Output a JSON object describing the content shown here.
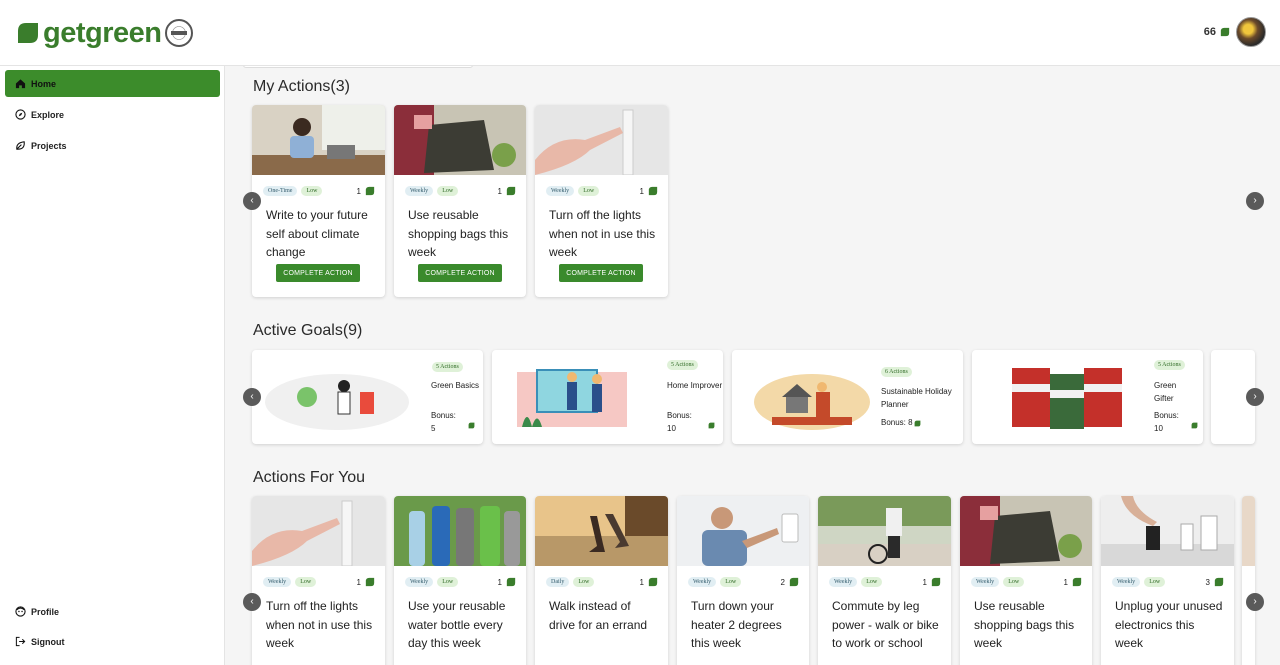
{
  "header": {
    "logo_text": "getgreen",
    "points": "66"
  },
  "sidebar": {
    "items": [
      {
        "label": "Home",
        "icon": "home-icon"
      },
      {
        "label": "Explore",
        "icon": "compass-icon"
      },
      {
        "label": "Projects",
        "icon": "leaf-outline-icon"
      }
    ],
    "bottom_items": [
      {
        "label": "Profile",
        "icon": "profile-face-icon"
      },
      {
        "label": "Signout",
        "icon": "signout-icon"
      }
    ]
  },
  "my_actions": {
    "title": "My Actions(3)",
    "complete_label": "COMPLETE ACTION",
    "cards": [
      {
        "frequency": "One-Time",
        "impact": "Low",
        "points": "1",
        "title": "Write to your future self about climate change"
      },
      {
        "frequency": "Weekly",
        "impact": "Low",
        "points": "1",
        "title": "Use reusable shopping bags this week"
      },
      {
        "frequency": "Weekly",
        "impact": "Low",
        "points": "1",
        "title": "Turn off the lights when not in use this week"
      }
    ]
  },
  "active_goals": {
    "title": "Active Goals(9)",
    "bonus_label": "Bonus:",
    "goals": [
      {
        "actions": "5 Actions",
        "name": "Green Basics",
        "bonus": "5"
      },
      {
        "actions": "5 Actions",
        "name": "Home Improver",
        "bonus": "10"
      },
      {
        "actions": "6 Actions",
        "name": "Sustainable Holiday Planner",
        "bonus": "8"
      },
      {
        "actions": "5 Actions",
        "name": "Green Gifter",
        "bonus": "10"
      }
    ]
  },
  "actions_for_you": {
    "title": "Actions For You",
    "cards": [
      {
        "frequency": "Weekly",
        "impact": "Low",
        "points": "1",
        "title": "Turn off the lights when not in use this week"
      },
      {
        "frequency": "Weekly",
        "impact": "Low",
        "points": "1",
        "title": "Use your reusable water bottle every day this week"
      },
      {
        "frequency": "Daily",
        "impact": "Low",
        "points": "1",
        "title": "Walk instead of drive for an errand"
      },
      {
        "frequency": "Weekly",
        "impact": "Low",
        "points": "2",
        "title": "Turn down your heater 2 degrees this week"
      },
      {
        "frequency": "Weekly",
        "impact": "Low",
        "points": "1",
        "title": "Commute by leg power - walk or bike to work or school"
      },
      {
        "frequency": "Weekly",
        "impact": "Low",
        "points": "1",
        "title": "Use reusable shopping bags this week"
      },
      {
        "frequency": "Weekly",
        "impact": "Low",
        "points": "3",
        "title": "Unplug your unused electronics this week"
      }
    ]
  },
  "colors": {
    "brand_green": "#3a7d2c",
    "active_nav": "#3c8c2b",
    "button_green": "#3a8a2c"
  }
}
